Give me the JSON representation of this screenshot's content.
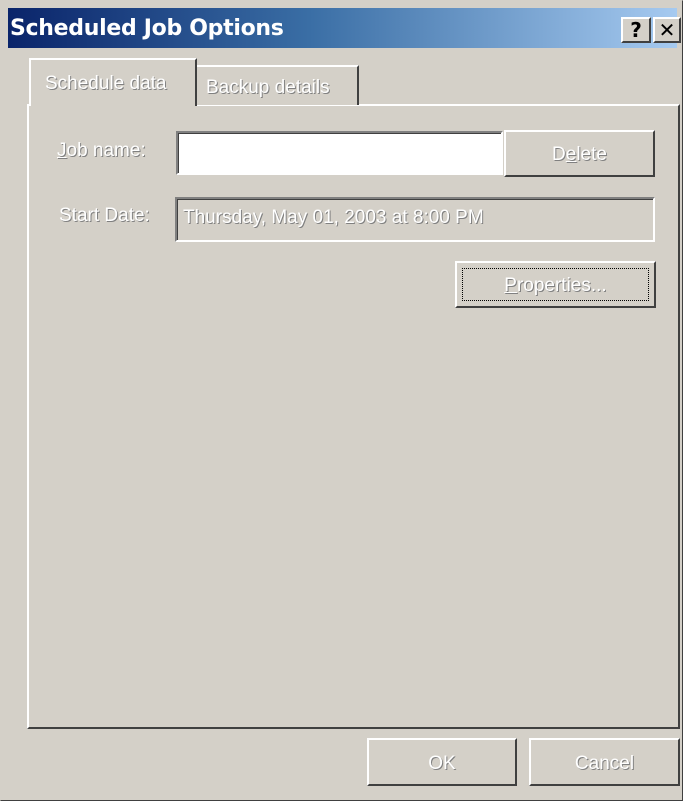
{
  "window": {
    "title": "Scheduled Job Options",
    "help_button": "?",
    "close_button": "✕"
  },
  "tabs": [
    {
      "label": "Schedule data",
      "active": true
    },
    {
      "label": "Backup details",
      "active": false
    }
  ],
  "form": {
    "job_name": {
      "label_prefix": "",
      "label_accel": "J",
      "label_rest": "ob name:",
      "value": ""
    },
    "start_date": {
      "label": "Start Date:",
      "value": "Thursday, May 01, 2003 at 8:00 PM"
    }
  },
  "buttons": {
    "delete": {
      "prefix": "D",
      "accel": "e",
      "rest": "lete"
    },
    "properties": {
      "prefix": "",
      "accel": "P",
      "rest": "roperties..."
    },
    "ok": "OK",
    "cancel": "Cancel"
  },
  "colors": {
    "title_gradient_start": "#0a246a",
    "title_gradient_end": "#a6caf0",
    "face": "#d4d0c8",
    "disabled_text": "#ffffff",
    "disabled_shadow": "#808080"
  }
}
